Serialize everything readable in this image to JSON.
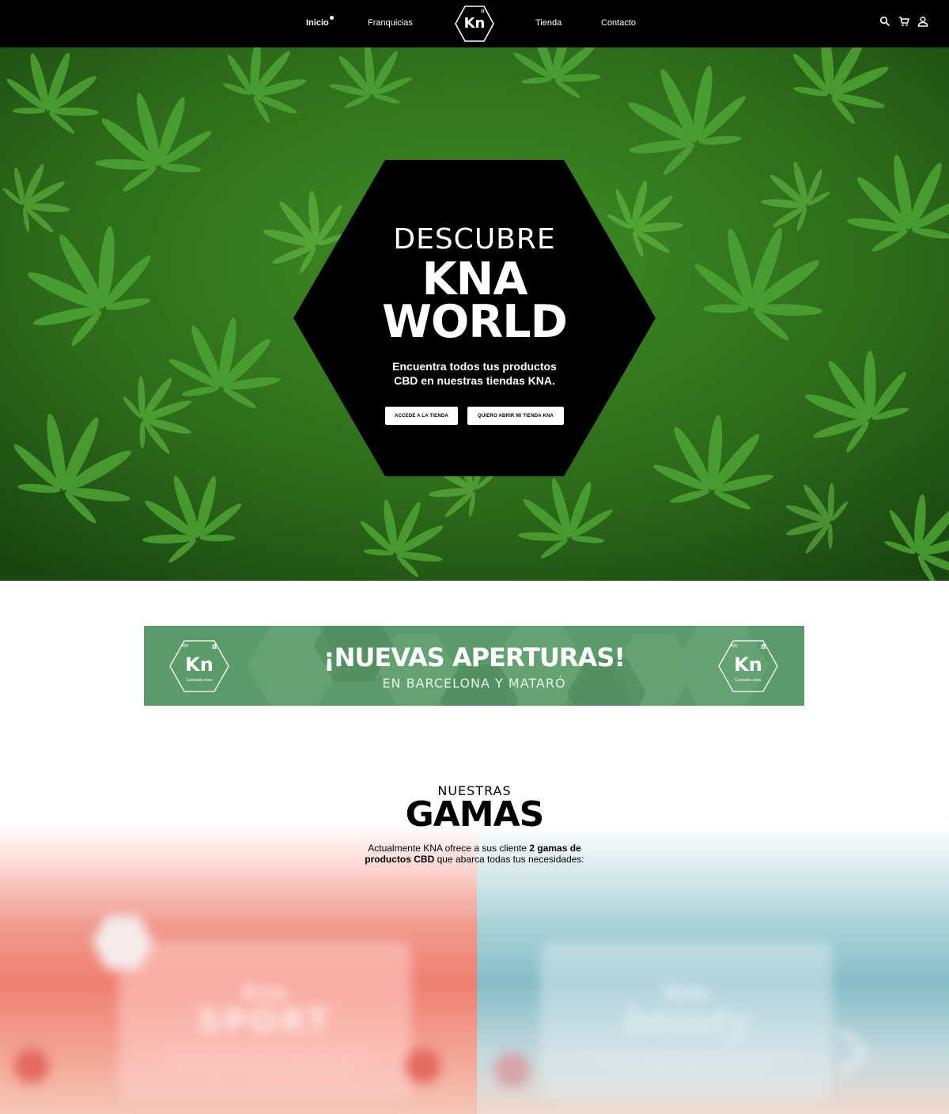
{
  "nav": {
    "items": [
      {
        "label": "Inicio",
        "active": true
      },
      {
        "label": "Franquicias"
      },
      {
        "label": "Tienda"
      },
      {
        "label": "Contacto"
      }
    ],
    "logo_text": "Kn",
    "logo_sup": "a",
    "icons": [
      "search-icon",
      "cart-icon",
      "user-icon"
    ]
  },
  "hero": {
    "line1": "DESCUBRE",
    "line2": "KNA",
    "line3": "WORLD",
    "text_line1": "Encuentra todos tus productos",
    "text_line2": "CBD en nuestras tiendas KNA.",
    "button1": "ACCEDE A LA TIENDA",
    "button2": "QUIERO ABRIR MI TIENDA KNA"
  },
  "banner": {
    "title": "¡NUEVAS APERTURAS!",
    "subtitle": "EN BARCELONA Y MATARÓ",
    "logo_text": "Kn",
    "logo_sup": "a",
    "logo_num": "420",
    "logo_caption": "Cannabis store"
  },
  "gamas": {
    "label": "NUESTRAS",
    "title": "GAMAS",
    "desc_1": "Actualmente KNA ofrece a sus cliente ",
    "desc_bold_1": "2 gamas de",
    "desc_bold_2": "productos CBD",
    "desc_2": " que abarca todas tus necesidades:"
  },
  "panels": {
    "sport_brand": "Kna",
    "sport_name": "SPORT",
    "sport_text": "La gama SPORT de Kna ofrece productos 100% naturales hechos a base de CBD pensados para deportistas.",
    "beauty_brand": "Kna",
    "beauty_name": "beauty",
    "beauty_text": "La gama BEAUTY de Kna te proporciona una piel sana gracias a nuestros productos CBD de máxima calidad."
  },
  "colors": {
    "nav_bg": "#000000",
    "banner_green": "#5a9b68",
    "sport_red": "#ef7f70",
    "beauty_blue": "#86bdc8"
  }
}
